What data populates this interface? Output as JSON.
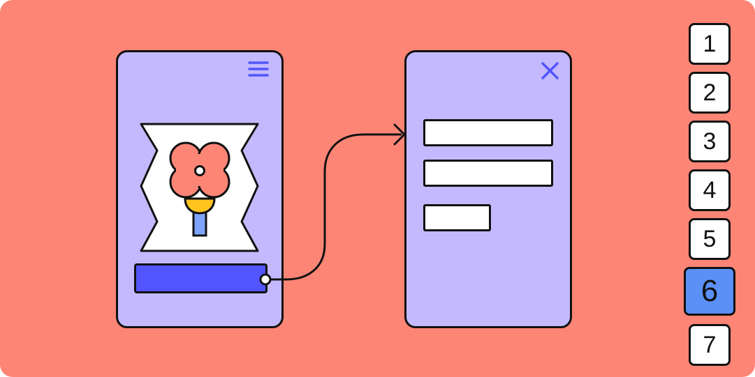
{
  "steps": {
    "items": [
      {
        "label": "1",
        "active": false
      },
      {
        "label": "2",
        "active": false
      },
      {
        "label": "3",
        "active": false
      },
      {
        "label": "4",
        "active": false
      },
      {
        "label": "5",
        "active": false
      },
      {
        "label": "6",
        "active": true
      },
      {
        "label": "7",
        "active": false
      }
    ]
  },
  "icons": {
    "menu": "hamburger-menu-icon",
    "close": "close-x-icon",
    "illustration": "flower-icon"
  },
  "colors": {
    "background": "#fd8576",
    "screen": "#c4b9fe",
    "primary_button": "#5255fd",
    "active_step": "#5b90f6",
    "accent_yellow": "#fec31f",
    "accent_blue": "#7fa4fb"
  }
}
